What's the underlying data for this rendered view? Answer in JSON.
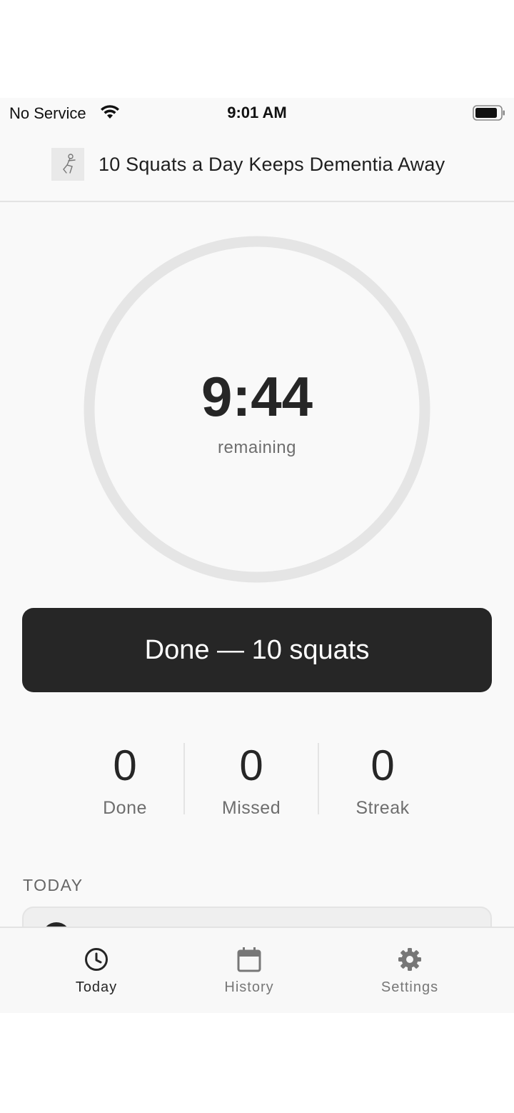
{
  "status_bar": {
    "carrier": "No Service",
    "time": "9:01 AM",
    "battery_icon": "battery-full-icon",
    "wifi_icon": "wifi-icon"
  },
  "header": {
    "title": "10 Squats a Day Keeps Dementia Away",
    "logo_icon": "squat-figure-icon"
  },
  "timer": {
    "value": "9:44",
    "caption": "remaining"
  },
  "done_button": {
    "label": "Done — 10 squats"
  },
  "stats": [
    {
      "value": "0",
      "label": "Done"
    },
    {
      "value": "0",
      "label": "Missed"
    },
    {
      "value": "0",
      "label": "Streak"
    }
  ],
  "today": {
    "heading": "TODAY"
  },
  "tabs": [
    {
      "label": "Today",
      "icon": "clock-icon",
      "active": true
    },
    {
      "label": "History",
      "icon": "calendar-icon",
      "active": false
    },
    {
      "label": "Settings",
      "icon": "gear-icon",
      "active": false
    }
  ],
  "colors": {
    "background": "#f9f9f9",
    "primary": "#262626",
    "ring": "#e5e5e5",
    "muted_text": "#6e6e6e"
  }
}
